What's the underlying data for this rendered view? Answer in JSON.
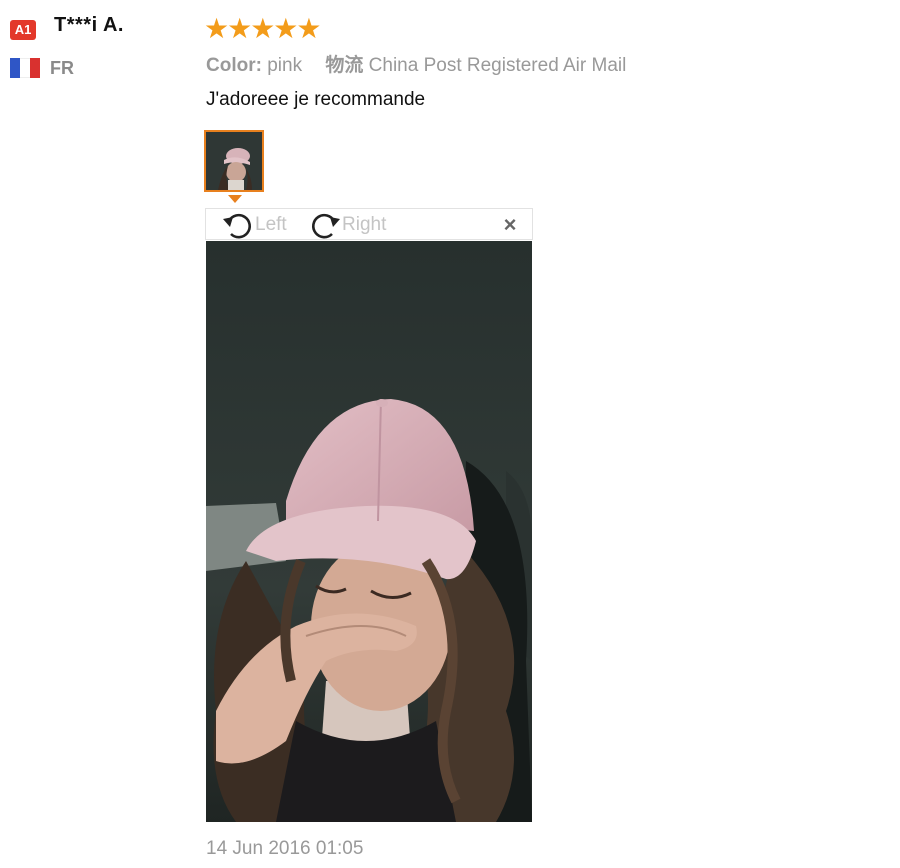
{
  "reviewer": {
    "level_badge": "A1",
    "name": "T***i A.",
    "country": "FR",
    "flag_colors": [
      "#2f56c6",
      "#ffffff",
      "#d9312f"
    ]
  },
  "review": {
    "rating": 5,
    "stars": "★★★★★",
    "star_color": "#f39c1a",
    "color_label": "Color:",
    "color_value": "pink",
    "shipping_label": "物流",
    "shipping_value": "China Post Registered Air Mail",
    "text": "J'adoreee je recommande",
    "date": "14 Jun 2016 01:05"
  },
  "viewer": {
    "rotate_left_label": "Left",
    "rotate_right_label": "Right",
    "close_glyph": "×",
    "accent_color": "#e8801e"
  }
}
